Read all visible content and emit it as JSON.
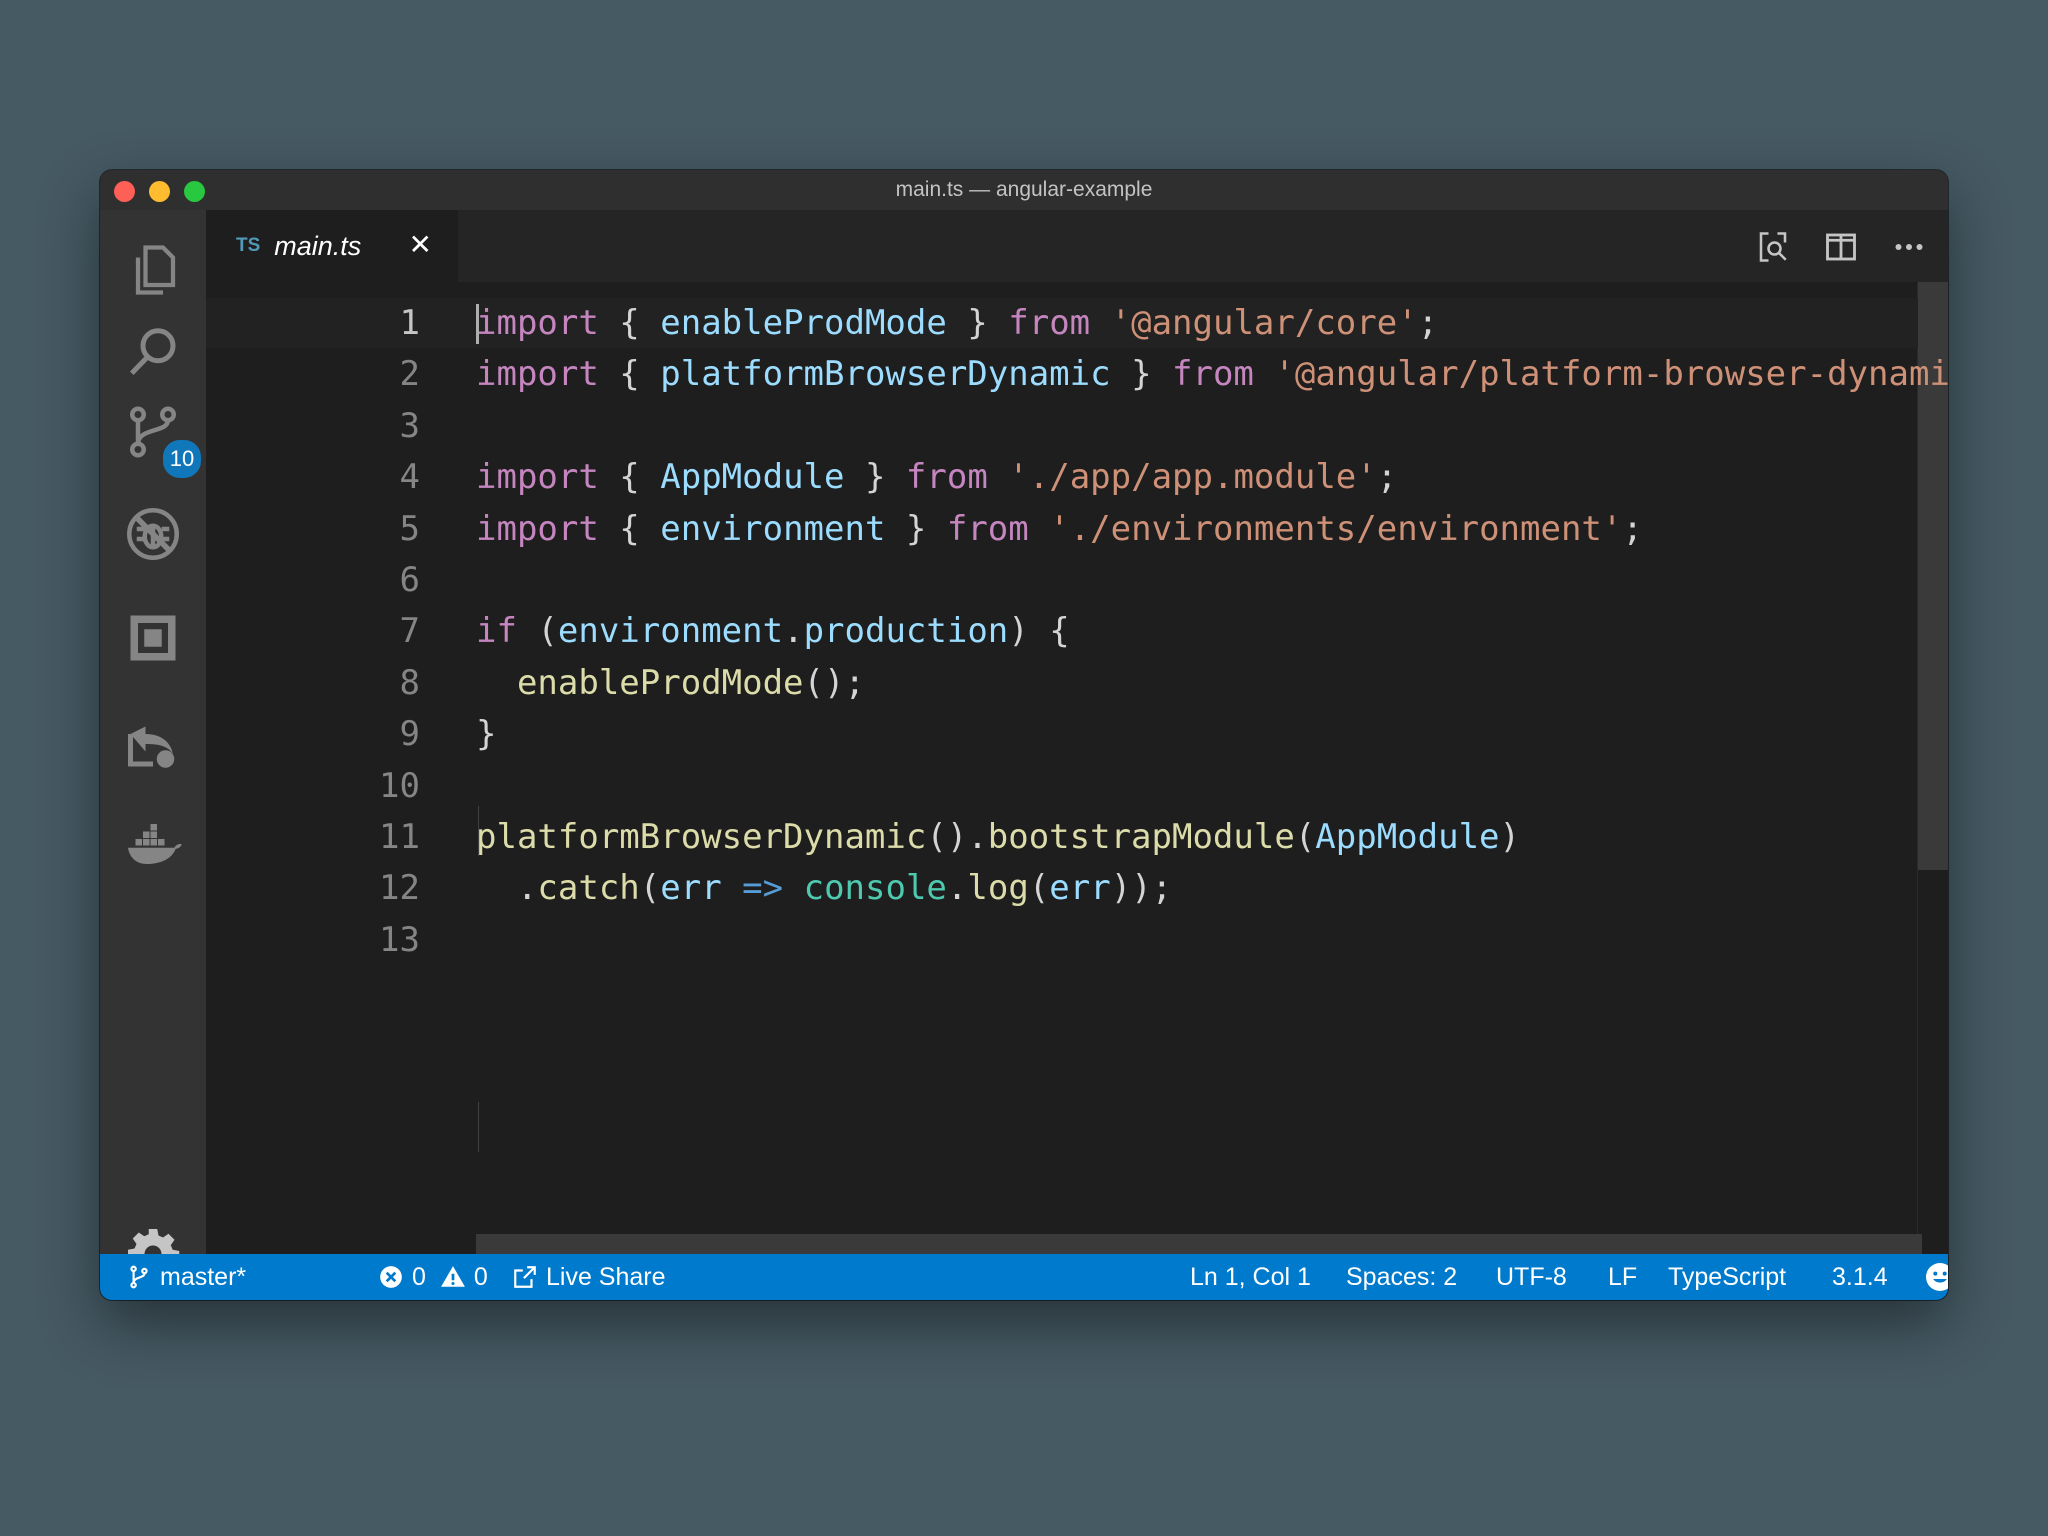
{
  "window": {
    "title": "main.ts — angular-example"
  },
  "activity_bar": {
    "items": [
      {
        "name": "explorer",
        "icon": "files-icon"
      },
      {
        "name": "search",
        "icon": "search-icon"
      },
      {
        "name": "source-control",
        "icon": "source-control-icon",
        "badge": "10"
      },
      {
        "name": "debug",
        "icon": "no-bug-icon"
      },
      {
        "name": "extensions",
        "icon": "extensions-icon"
      },
      {
        "name": "live-share",
        "icon": "live-share-icon"
      },
      {
        "name": "docker",
        "icon": "docker-icon"
      }
    ],
    "settings_icon": "gear-icon"
  },
  "tab": {
    "lang": "TS",
    "filename": "main.ts",
    "close_glyph": "✕"
  },
  "editor": {
    "lines": [
      {
        "n": "1",
        "tokens": [
          [
            "kw",
            "import"
          ],
          [
            "pn",
            " { "
          ],
          [
            "id",
            "enableProdMode"
          ],
          [
            "pn",
            " } "
          ],
          [
            "kw",
            "from"
          ],
          [
            "pn",
            " "
          ],
          [
            "str",
            "'@angular/core'"
          ],
          [
            "pn",
            ";"
          ]
        ]
      },
      {
        "n": "2",
        "tokens": [
          [
            "kw",
            "import"
          ],
          [
            "pn",
            " { "
          ],
          [
            "id",
            "platformBrowserDynamic"
          ],
          [
            "pn",
            " } "
          ],
          [
            "kw",
            "from"
          ],
          [
            "pn",
            " "
          ],
          [
            "str",
            "'@angular/platform-browser-dynamic'"
          ],
          [
            "pn",
            ";"
          ]
        ]
      },
      {
        "n": "3",
        "tokens": []
      },
      {
        "n": "4",
        "tokens": [
          [
            "kw",
            "import"
          ],
          [
            "pn",
            " { "
          ],
          [
            "id",
            "AppModule"
          ],
          [
            "pn",
            " } "
          ],
          [
            "kw",
            "from"
          ],
          [
            "pn",
            " "
          ],
          [
            "str",
            "'./app/app.module'"
          ],
          [
            "pn",
            ";"
          ]
        ]
      },
      {
        "n": "5",
        "tokens": [
          [
            "kw",
            "import"
          ],
          [
            "pn",
            " { "
          ],
          [
            "id",
            "environment"
          ],
          [
            "pn",
            " } "
          ],
          [
            "kw",
            "from"
          ],
          [
            "pn",
            " "
          ],
          [
            "str",
            "'./environments/environment'"
          ],
          [
            "pn",
            ";"
          ]
        ]
      },
      {
        "n": "6",
        "tokens": []
      },
      {
        "n": "7",
        "tokens": [
          [
            "kw",
            "if"
          ],
          [
            "pn",
            " ("
          ],
          [
            "id",
            "environment"
          ],
          [
            "pn",
            "."
          ],
          [
            "id",
            "production"
          ],
          [
            "pn",
            ") {"
          ]
        ]
      },
      {
        "n": "8",
        "tokens": [
          [
            "pn",
            "  "
          ],
          [
            "fn",
            "enableProdMode"
          ],
          [
            "pn",
            "();"
          ]
        ]
      },
      {
        "n": "9",
        "tokens": [
          [
            "pn",
            "}"
          ]
        ]
      },
      {
        "n": "10",
        "tokens": []
      },
      {
        "n": "11",
        "tokens": [
          [
            "fn",
            "platformBrowserDynamic"
          ],
          [
            "pn",
            "()."
          ],
          [
            "fn",
            "bootstrapModule"
          ],
          [
            "pn",
            "("
          ],
          [
            "id",
            "AppModule"
          ],
          [
            "pn",
            ")"
          ]
        ]
      },
      {
        "n": "12",
        "tokens": [
          [
            "pn",
            "  ."
          ],
          [
            "fn",
            "catch"
          ],
          [
            "pn",
            "("
          ],
          [
            "id",
            "err"
          ],
          [
            "pn",
            " "
          ],
          [
            "op",
            "=>"
          ],
          [
            "pn",
            " "
          ],
          [
            "cls",
            "console"
          ],
          [
            "pn",
            "."
          ],
          [
            "fn",
            "log"
          ],
          [
            "pn",
            "("
          ],
          [
            "id",
            "err"
          ],
          [
            "pn",
            "));"
          ]
        ]
      },
      {
        "n": "13",
        "tokens": []
      }
    ]
  },
  "status_bar": {
    "branch": "master*",
    "errors": "0",
    "warnings": "0",
    "live_share": "Live Share",
    "position": "Ln 1, Col 1",
    "spaces": "Spaces: 2",
    "encoding": "UTF-8",
    "eol": "LF",
    "language": "TypeScript",
    "version": "3.1.4"
  },
  "colors": {
    "status_bar": "#007acc",
    "keyword": "#c586c0",
    "identifier": "#9cdcfe",
    "string": "#ce9178",
    "function": "#dcdcaa"
  }
}
